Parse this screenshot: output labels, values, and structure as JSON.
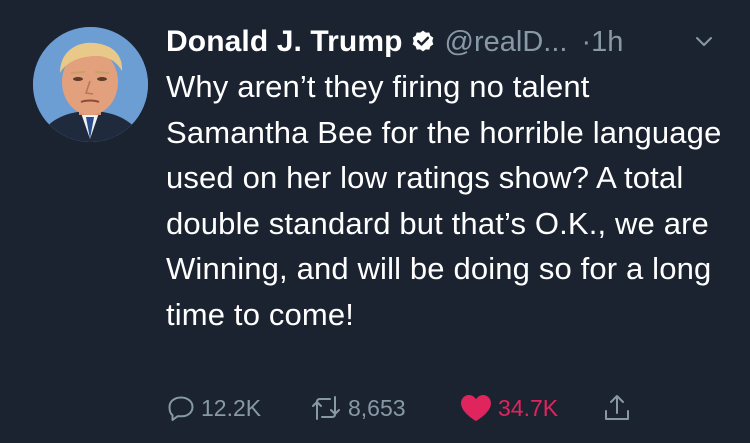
{
  "tweet": {
    "display_name": "Donald J. Trump",
    "handle": "@realD...",
    "timestamp": "·1h",
    "text": "Why aren’t they firing no talent Samantha Bee for the horrible language used on her low ratings show? A total double standard but that’s O.K., we are Winning, and will be doing so for a long time to come!",
    "replies": "12.2K",
    "retweets": "8,653",
    "likes": "34.7K"
  },
  "icons": {
    "verified": "verified-badge-icon",
    "caret": "chevron-down-icon",
    "reply": "reply-icon",
    "retweet": "retweet-icon",
    "like": "heart-icon",
    "share": "share-icon"
  },
  "colors": {
    "background": "#1b2330",
    "text": "#ffffff",
    "muted": "#8899a6",
    "like": "#e0245e"
  }
}
